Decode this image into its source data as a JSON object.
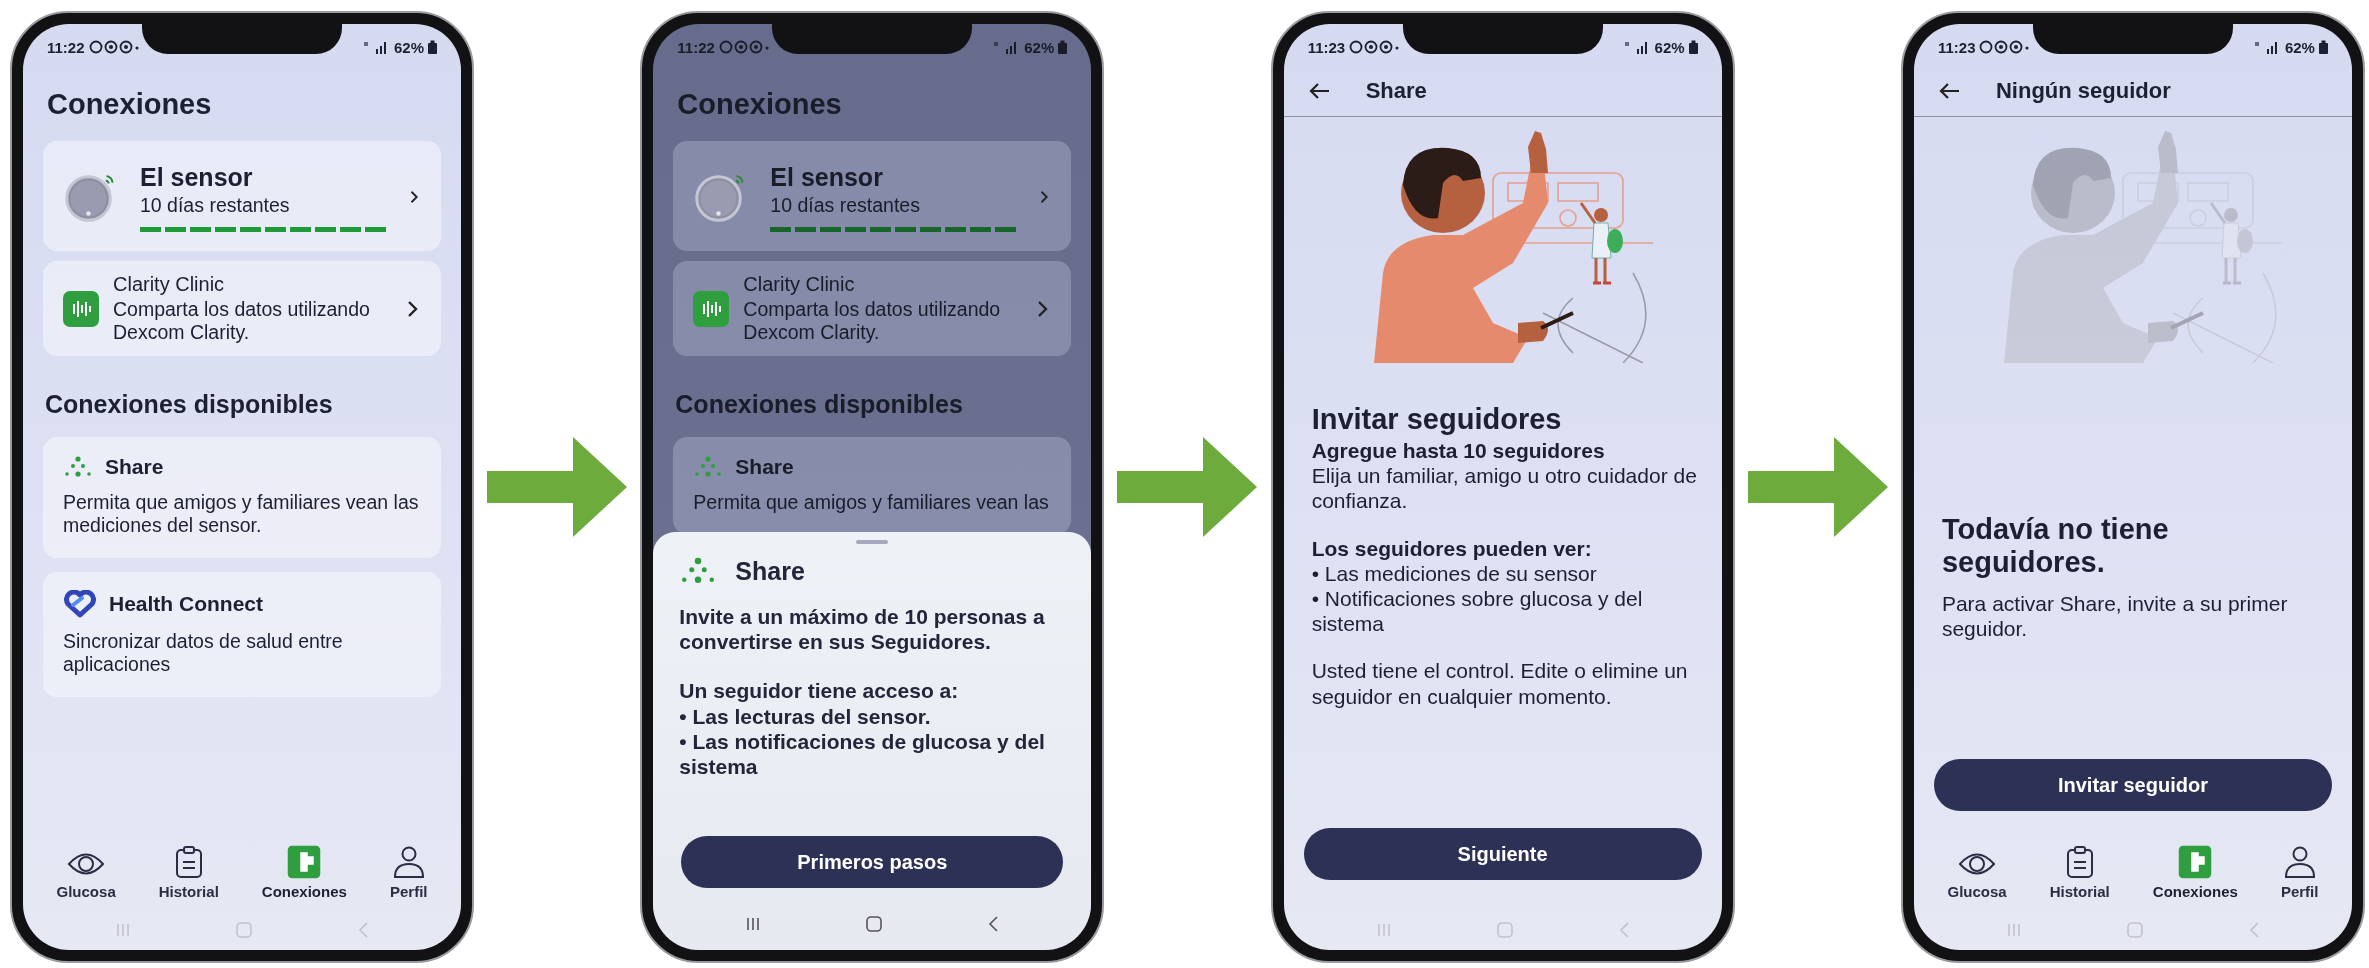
{
  "screens": [
    {
      "kind": "connections",
      "dimmed": false,
      "status_bar": {
        "time": "11:22",
        "battery": "62%"
      },
      "title": "Conexiones",
      "sensor": {
        "title": "El sensor",
        "subtitle": "10 días restantes",
        "level": 1
      },
      "clinic": {
        "title": "Clarity Clinic",
        "description": "Comparta los datos utilizando Dexcom Clarity."
      },
      "section_title": "Conexiones disponibles",
      "available": [
        {
          "kind": "share",
          "title": "Share",
          "description": "Permita que amigos y familiares vean las mediciones del sensor."
        },
        {
          "kind": "health",
          "title": "Health Connect",
          "description": "Sincronizar datos de salud entre aplicaciones"
        }
      ],
      "nav": [
        {
          "label": "Glucosa",
          "selected": false
        },
        {
          "label": "Historial",
          "selected": false
        },
        {
          "label": "Conexiones",
          "selected": true
        },
        {
          "label": "Perfil",
          "selected": false
        }
      ]
    },
    {
      "kind": "connections",
      "dimmed": true,
      "status_bar": {
        "time": "11:22",
        "battery": "62%"
      },
      "title": "Conexiones",
      "sensor": {
        "title": "El sensor",
        "subtitle": "10 días restantes",
        "level": 1
      },
      "clinic": {
        "title": "Clarity Clinic",
        "description": "Comparta los datos utilizando Dexcom Clarity."
      },
      "section_title": "Conexiones disponibles",
      "available": [
        {
          "kind": "share",
          "title": "Share",
          "description": "Permita que amigos y familiares vean las"
        }
      ],
      "sheet": {
        "title": "Share",
        "sections": [
          [
            "Invite a un máximo de 10 personas a convertirse en sus Seguidores."
          ],
          [
            "Un seguidor tiene acceso a:",
            "• Las lecturas del sensor.",
            "• Las notificaciones de glucosa y del sistema"
          ]
        ],
        "button": "Primeros pasos"
      }
    },
    {
      "kind": "intro",
      "status_bar": {
        "time": "11:23",
        "battery": "62%"
      },
      "header": {
        "title": "Share"
      },
      "illustration": {
        "faded": false
      },
      "heading": "Invitar seguidores",
      "sections": [
        [
          {
            "kind": "lead",
            "text": "Agregue hasta 10 seguidores"
          },
          {
            "kind": "text",
            "text": "Elija un familiar, amigo u otro cuidador de confianza."
          }
        ],
        [
          {
            "kind": "lead",
            "text": "Los seguidores pueden ver:"
          },
          {
            "kind": "text",
            "text": "• Las mediciones de su sensor"
          },
          {
            "kind": "text",
            "text": "• Notificaciones sobre glucosa y del sistema"
          }
        ],
        [
          {
            "kind": "text",
            "text": "Usted tiene el control. Edite o elimine un seguidor en cualquier momento."
          }
        ]
      ],
      "button": "Siguiente"
    },
    {
      "kind": "empty",
      "status_bar": {
        "time": "11:23",
        "battery": "62%"
      },
      "header": {
        "title": "Ningún seguidor"
      },
      "illustration": {
        "faded": true
      },
      "heading": "Todavía no tiene seguidores.",
      "text": "Para activar Share, invite a su primer seguidor.",
      "button": "Invitar seguidor",
      "nav": [
        {
          "label": "Glucosa",
          "selected": false
        },
        {
          "label": "Historial",
          "selected": false
        },
        {
          "label": "Conexiones",
          "selected": true
        },
        {
          "label": "Perfil",
          "selected": false
        }
      ]
    }
  ]
}
